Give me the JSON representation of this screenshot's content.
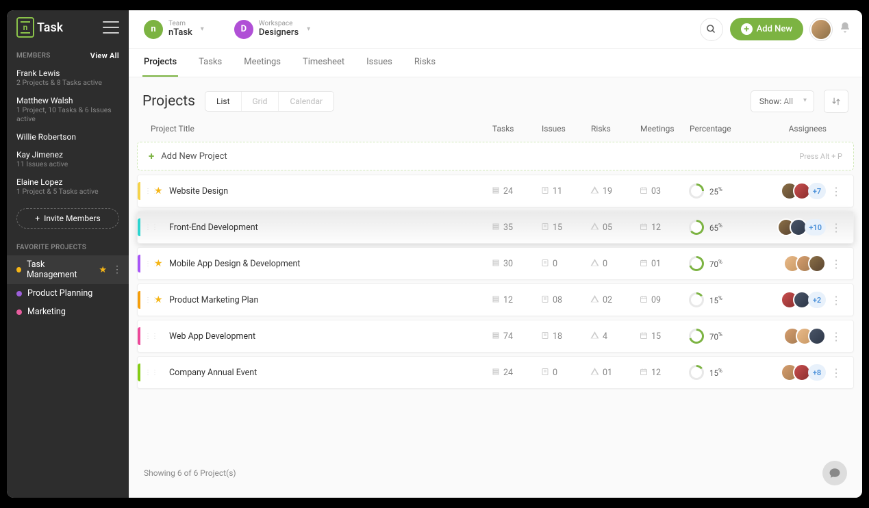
{
  "brand": "Task",
  "sidebar": {
    "members_label": "MEMBERS",
    "view_all": "View All",
    "members": [
      {
        "name": "Frank Lewis",
        "sub": "2 Projects & 8 Tasks active"
      },
      {
        "name": "Matthew Walsh",
        "sub": "1 Project, 10 Tasks & 6 Issues active"
      },
      {
        "name": "Willie Robertson",
        "sub": ""
      },
      {
        "name": "Kay Jimenez",
        "sub": "11 Issues active"
      },
      {
        "name": "Elaine Lopez",
        "sub": "1 Project & 5 Tasks active"
      }
    ],
    "invite_label": "Invite Members",
    "fav_label": "FAVORITE PROJECTS",
    "favorites": [
      {
        "name": "Task Management",
        "color": "#f5b516",
        "starred": true,
        "selected": true
      },
      {
        "name": "Product Planning",
        "color": "#9c5fd9",
        "starred": false,
        "selected": false
      },
      {
        "name": "Marketing",
        "color": "#e85d9e",
        "starred": false,
        "selected": false
      }
    ]
  },
  "header": {
    "team_label": "Team",
    "team_value": "nTask",
    "team_color": "#7cb342",
    "team_chip": "n",
    "ws_label": "Workspace",
    "ws_value": "Designers",
    "ws_color": "#b050d6",
    "ws_chip": "D",
    "add_new": "Add New"
  },
  "tabs": [
    "Projects",
    "Tasks",
    "Meetings",
    "Timesheet",
    "Issues",
    "Risks"
  ],
  "active_tab": "Projects",
  "page_title": "Projects",
  "views": [
    "List",
    "Grid",
    "Calendar"
  ],
  "active_view": "List",
  "show_label": "Show:",
  "show_value": "All",
  "columns": {
    "title": "Project Title",
    "tasks": "Tasks",
    "issues": "Issues",
    "risks": "Risks",
    "meetings": "Meetings",
    "pct": "Percentage",
    "asg": "Assignees"
  },
  "add_row": {
    "label": "Add New Project",
    "hint": "Press Alt + P"
  },
  "projects": [
    {
      "bar": "#f5d34a",
      "star": true,
      "title": "Website Design",
      "tasks": "24",
      "issues": "11",
      "risks": "19",
      "meetings": "03",
      "pct": 25,
      "avatars": [
        "av1",
        "av2"
      ],
      "more": "+7"
    },
    {
      "bar": "#2dd4cf",
      "star": false,
      "title": "Front-End Development",
      "tasks": "35",
      "issues": "15",
      "risks": "05",
      "meetings": "12",
      "pct": 65,
      "avatars": [
        "av1",
        "av4"
      ],
      "more": "+10",
      "highlight": true
    },
    {
      "bar": "#a855f7",
      "star": true,
      "title": "Mobile App Design & Development",
      "tasks": "30",
      "issues": "0",
      "risks": "0",
      "meetings": "01",
      "pct": 70,
      "avatars": [
        "av3",
        "av5",
        "av1"
      ],
      "more": ""
    },
    {
      "bar": "#f59e0b",
      "star": true,
      "title": "Product Marketing Plan",
      "tasks": "12",
      "issues": "08",
      "risks": "02",
      "meetings": "09",
      "pct": 15,
      "avatars": [
        "av2",
        "av4"
      ],
      "more": "+2"
    },
    {
      "bar": "#ec4899",
      "star": false,
      "title": "Web App Development",
      "tasks": "74",
      "issues": "18",
      "risks": "4",
      "meetings": "15",
      "pct": 70,
      "avatars": [
        "av5",
        "av3",
        "av4"
      ],
      "more": ""
    },
    {
      "bar": "#84cc16",
      "star": false,
      "title": "Company Annual Event",
      "tasks": "24",
      "issues": "0",
      "risks": "01",
      "meetings": "12",
      "pct": 15,
      "avatars": [
        "av5",
        "av2"
      ],
      "more": "+8"
    }
  ],
  "footer": "Showing 6 of 6 Project(s)"
}
